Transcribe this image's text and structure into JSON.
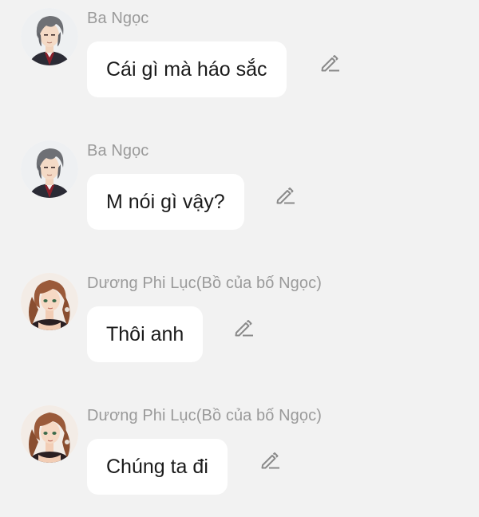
{
  "messages": [
    {
      "sender": "Ba Ngọc",
      "text": "Cái gì mà háo sắc",
      "avatar_icon": "male-character-avatar",
      "edit_icon": "pencil-edit-icon"
    },
    {
      "sender": "Ba Ngọc",
      "text": "M nói gì vậy?",
      "avatar_icon": "male-character-avatar",
      "edit_icon": "pencil-edit-icon"
    },
    {
      "sender": "Dương Phi Lục(Bồ của bố Ngọc)",
      "text": "Thôi anh",
      "avatar_icon": "female-character-avatar",
      "edit_icon": "pencil-edit-icon"
    },
    {
      "sender": "Dương Phi Lục(Bồ của bố Ngọc)",
      "text": "Chúng ta đi",
      "avatar_icon": "female-character-avatar",
      "edit_icon": "pencil-edit-icon"
    }
  ],
  "colors": {
    "background": "#f2f2f2",
    "bubble": "#ffffff",
    "sender_text": "#9a9a9a",
    "message_text": "#1a1a1a",
    "icon": "#8a8a8a"
  }
}
